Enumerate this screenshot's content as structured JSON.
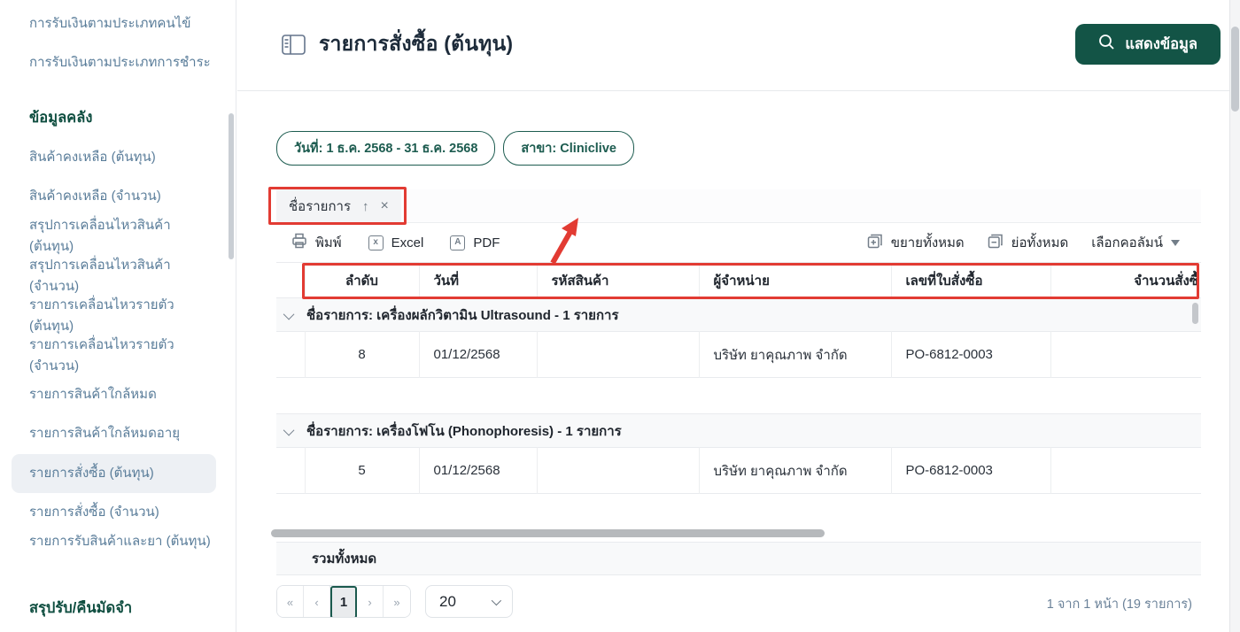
{
  "colors": {
    "brand_green": "#135446",
    "annotation_red": "#e23b33",
    "sidebar_link": "#5a7d9a",
    "header_green": "#0f4e40"
  },
  "sidebar": {
    "items": [
      {
        "label": "การรับเงินตามประเภทคนไข้",
        "kind": "link"
      },
      {
        "label": "การรับเงินตามประเภทการชำระ",
        "kind": "link"
      },
      {
        "label": "ข้อมูลคลัง",
        "kind": "header"
      },
      {
        "label": "สินค้าคงเหลือ (ต้นทุน)",
        "kind": "link"
      },
      {
        "label": "สินค้าคงเหลือ (จำนวน)",
        "kind": "link"
      },
      {
        "label": "สรุปการเคลื่อนไหวสินค้า (ต้นทุน)",
        "kind": "link"
      },
      {
        "label": "สรุปการเคลื่อนไหวสินค้า (จำนวน)",
        "kind": "link"
      },
      {
        "label": "รายการเคลื่อนไหวรายตัว (ต้นทุน)",
        "kind": "link"
      },
      {
        "label": "รายการเคลื่อนไหวรายตัว (จำนวน)",
        "kind": "link"
      },
      {
        "label": "รายการสินค้าใกล้หมด",
        "kind": "link"
      },
      {
        "label": "รายการสินค้าใกล้หมดอายุ",
        "kind": "link"
      },
      {
        "label": "รายการสั่งซื้อ (ต้นทุน)",
        "kind": "link-active"
      },
      {
        "label": "รายการสั่งซื้อ (จำนวน)",
        "kind": "link"
      },
      {
        "label": "รายการรับสินค้าและยา (ต้นทุน)",
        "kind": "link"
      },
      {
        "label": "สรุปรับ/คืนมัดจำ",
        "kind": "header"
      }
    ]
  },
  "header": {
    "title": "รายการสั่งซื้อ (ต้นทุน)",
    "show_data_button": "แสดงข้อมูล"
  },
  "filters": {
    "date_chip": "วันที่: 1 ธ.ค. 2568 - 31 ธ.ค. 2568",
    "branch_chip": "สาขา: Cliniclive"
  },
  "group_panel": {
    "field": "ชื่อรายการ",
    "sort_icon": "↑",
    "remove_icon": "×"
  },
  "toolbar": {
    "print": "พิมพ์",
    "excel": "Excel",
    "pdf": "PDF",
    "expand_all": "ขยายทั้งหมด",
    "collapse_all": "ย่อทั้งหมด",
    "choose_columns": "เลือกคอลัมน์",
    "excel_glyph": "x",
    "pdf_glyph": "A"
  },
  "table": {
    "columns": [
      "ลำดับ",
      "วันที่",
      "รหัสสินค้า",
      "ผู้จำหน่าย",
      "เลขที่ใบสั่งซื้อ",
      "จำนวนสั่งซื้"
    ],
    "groups": [
      {
        "title": "ชื่อรายการ: เครื่องผลักวิตามิน Ultrasound - 1 รายการ",
        "rows": [
          {
            "seq": "8",
            "date": "01/12/2568",
            "product_code": "",
            "supplier": "บริษัท ยาคุณภาพ จำกัด",
            "po_number": "PO-6812-0003",
            "qty": ""
          }
        ]
      },
      {
        "title": "ชื่อรายการ: เครื่องโฟโน (Phonophoresis) - 1 รายการ",
        "rows": [
          {
            "seq": "5",
            "date": "01/12/2568",
            "product_code": "",
            "supplier": "บริษัท ยาคุณภาพ จำกัด",
            "po_number": "PO-6812-0003",
            "qty": ""
          }
        ]
      }
    ],
    "total_label": "รวมทั้งหมด"
  },
  "pagination": {
    "first": "«",
    "prev": "‹",
    "page": "1",
    "next": "›",
    "last": "»",
    "page_size": "20",
    "info": "1 จาก 1 หน้า (19 รายการ)"
  }
}
